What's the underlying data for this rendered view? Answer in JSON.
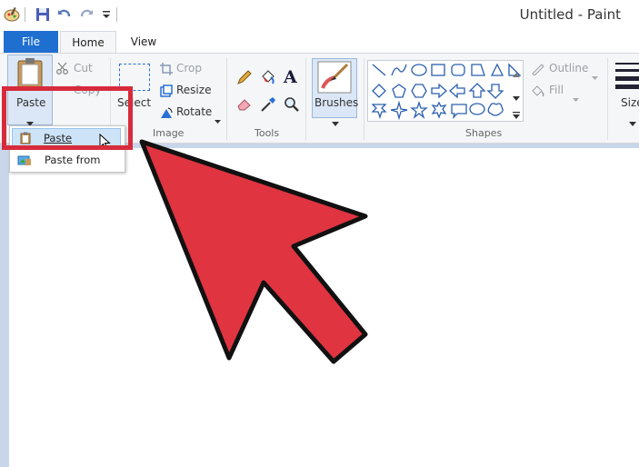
{
  "window": {
    "title": "Untitled - Paint"
  },
  "tabs": {
    "file": "File",
    "home": "Home",
    "view": "View"
  },
  "clipboard": {
    "paste_label": "Paste",
    "cut_label": "Cut",
    "copy_label": "Copy"
  },
  "image": {
    "select_label": "Select",
    "crop_label": "Crop",
    "resize_label": "Resize",
    "rotate_label": "Rotate",
    "group_label": "Image"
  },
  "tools": {
    "group_label": "Tools"
  },
  "brushes": {
    "label": "Brushes"
  },
  "shapes": {
    "group_label": "Shapes",
    "outline_label": "Outline",
    "fill_label": "Fill"
  },
  "size": {
    "label": "Size"
  },
  "paste_menu": {
    "items": [
      {
        "label": "Paste",
        "underline": "P"
      },
      {
        "label": "Paste from",
        "underline": "f"
      }
    ]
  },
  "colors": {
    "file_tab": "#1f6fd1",
    "highlight": "#d72b3c",
    "arrow": "#e03441",
    "canvas_bg": "#c9d6ea"
  }
}
